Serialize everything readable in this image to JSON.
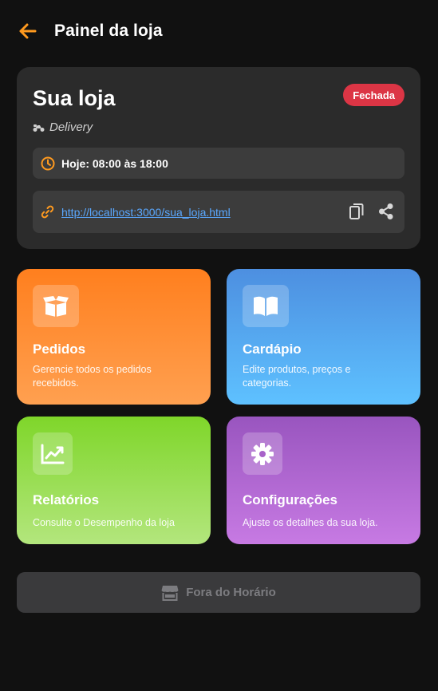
{
  "header": {
    "title": "Painel da loja",
    "back_icon": "arrow-left-icon",
    "accent_color": "#ff9a1f"
  },
  "store": {
    "name": "Sua loja",
    "status": "Fechada",
    "status_color": "#dc3545",
    "mode_icon": "motorcycle-icon",
    "mode": "Delivery",
    "hours_icon": "clock-icon",
    "hours": "Hoje: 08:00 às 18:00",
    "link_icon": "link-icon",
    "link": "http://localhost:3000/sua_loja.html",
    "copy_icon": "copy-icon",
    "share_icon": "share-icon"
  },
  "tiles": [
    {
      "title": "Pedidos",
      "description": "Gerencie todos os pedidos recebidos.",
      "icon": "box-open-icon",
      "color_start": "#ff7f1e",
      "color_end": "#ffa050"
    },
    {
      "title": "Cardápio",
      "description": "Edite produtos, preços e categorias.",
      "icon": "book-open-icon",
      "color_start": "#4d8fe0",
      "color_end": "#5ec1ff"
    },
    {
      "title": "Relatórios",
      "description": "Consulte o Desempenho da loja",
      "icon": "chart-line-icon",
      "color_start": "#7fd62a",
      "color_end": "#b3e67d"
    },
    {
      "title": "Configurações",
      "description": "Ajuste os detalhes da sua loja.",
      "icon": "gear-icon",
      "color_start": "#9955bf",
      "color_end": "#c77ae3"
    }
  ],
  "action": {
    "label": "Fora do Horário",
    "icon": "store-icon"
  }
}
